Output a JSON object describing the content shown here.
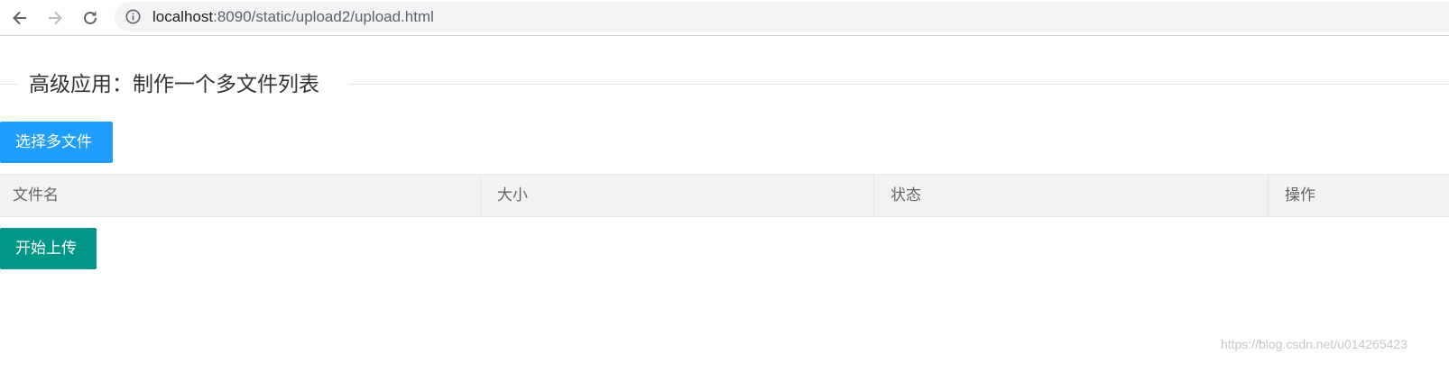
{
  "browser": {
    "url_host": "localhost",
    "url_rest": ":8090/static/upload2/upload.html"
  },
  "page": {
    "legend": "高级应用：制作一个多文件列表",
    "select_button": "选择多文件",
    "upload_button": "开始上传",
    "table_headers": [
      "文件名",
      "大小",
      "状态",
      "操作"
    ]
  },
  "watermark": "https://blog.csdn.net/u014265423"
}
